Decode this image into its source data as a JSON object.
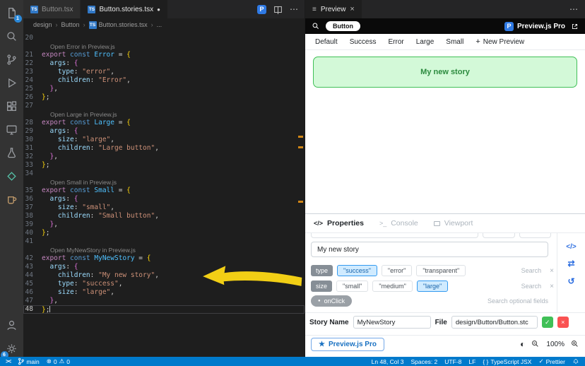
{
  "colors": {
    "accent": "#007acc",
    "preview_button_bg": "#d3f9d8",
    "preview_button_border": "#40c057",
    "selected_pill_bg": "#d0ebff",
    "annotation_arrow": "#f2cf15",
    "scroll_mark_orange": "#d18616"
  },
  "icons": {
    "ts": "TS",
    "p": "P",
    "ellipsis": "⋯",
    "close": "×",
    "dot": "●",
    "menu": "≡",
    "crumb_sep": "›",
    "code": "</>",
    "console": ">_",
    "swap": "⇄",
    "undo": "↺",
    "contrast": "◐",
    "star": "★",
    "check": "✓",
    "plus": "+",
    "braces": "{ }",
    "remote": "><",
    "error": "⊗",
    "warning": "⚠"
  },
  "activity_bar": {
    "explorer_badge": "1",
    "settings_badge": "6"
  },
  "tabs": [
    {
      "label": "Button.tsx"
    },
    {
      "label": "Button.stories.tsx"
    }
  ],
  "breadcrumb": {
    "items": [
      "design",
      "Button",
      "Button.stories.tsx",
      "..."
    ]
  },
  "editor": {
    "rows": [
      {
        "n": "20"
      },
      {
        "lens": "Open Error in Preview.js"
      },
      {
        "n": "21",
        "t": [
          [
            "k1",
            "export "
          ],
          [
            "k2",
            "const "
          ],
          [
            "nm",
            "Error"
          ],
          [
            "pn",
            " = "
          ],
          [
            "b1",
            "{"
          ]
        ]
      },
      {
        "n": "22",
        "t": [
          [
            "pn",
            "  "
          ],
          [
            "pr",
            "args"
          ],
          [
            "pn",
            ": "
          ],
          [
            "b2",
            "{"
          ]
        ]
      },
      {
        "n": "23",
        "t": [
          [
            "pn",
            "    "
          ],
          [
            "pr",
            "type"
          ],
          [
            "pn",
            ": "
          ],
          [
            "st",
            "\"error\""
          ],
          [
            "pn",
            ","
          ]
        ]
      },
      {
        "n": "24",
        "t": [
          [
            "pn",
            "    "
          ],
          [
            "pr",
            "children"
          ],
          [
            "pn",
            ": "
          ],
          [
            "st",
            "\"Error\""
          ],
          [
            "pn",
            ","
          ]
        ]
      },
      {
        "n": "25",
        "t": [
          [
            "pn",
            "  "
          ],
          [
            "b2",
            "}"
          ],
          [
            "pn",
            ","
          ]
        ]
      },
      {
        "n": "26",
        "t": [
          [
            "b1",
            "}"
          ],
          [
            "pn",
            ";"
          ]
        ]
      },
      {
        "n": "27"
      },
      {
        "lens": "Open Large in Preview.js"
      },
      {
        "n": "28",
        "t": [
          [
            "k1",
            "export "
          ],
          [
            "k2",
            "const "
          ],
          [
            "nm",
            "Large"
          ],
          [
            "pn",
            " = "
          ],
          [
            "b1",
            "{"
          ]
        ]
      },
      {
        "n": "29",
        "t": [
          [
            "pn",
            "  "
          ],
          [
            "pr",
            "args"
          ],
          [
            "pn",
            ": "
          ],
          [
            "b2",
            "{"
          ]
        ]
      },
      {
        "n": "30",
        "t": [
          [
            "pn",
            "    "
          ],
          [
            "pr",
            "size"
          ],
          [
            "pn",
            ": "
          ],
          [
            "st",
            "\"large\""
          ],
          [
            "pn",
            ","
          ]
        ]
      },
      {
        "n": "31",
        "t": [
          [
            "pn",
            "    "
          ],
          [
            "pr",
            "children"
          ],
          [
            "pn",
            ": "
          ],
          [
            "st",
            "\"Large button\""
          ],
          [
            "pn",
            ","
          ]
        ]
      },
      {
        "n": "32",
        "t": [
          [
            "pn",
            "  "
          ],
          [
            "b2",
            "}"
          ],
          [
            "pn",
            ","
          ]
        ]
      },
      {
        "n": "33",
        "t": [
          [
            "b1",
            "}"
          ],
          [
            "pn",
            ";"
          ]
        ]
      },
      {
        "n": "34"
      },
      {
        "lens": "Open Small in Preview.js"
      },
      {
        "n": "35",
        "t": [
          [
            "k1",
            "export "
          ],
          [
            "k2",
            "const "
          ],
          [
            "nm",
            "Small"
          ],
          [
            "pn",
            " = "
          ],
          [
            "b1",
            "{"
          ]
        ]
      },
      {
        "n": "36",
        "t": [
          [
            "pn",
            "  "
          ],
          [
            "pr",
            "args"
          ],
          [
            "pn",
            ": "
          ],
          [
            "b2",
            "{"
          ]
        ]
      },
      {
        "n": "37",
        "t": [
          [
            "pn",
            "    "
          ],
          [
            "pr",
            "size"
          ],
          [
            "pn",
            ": "
          ],
          [
            "st",
            "\"small\""
          ],
          [
            "pn",
            ","
          ]
        ]
      },
      {
        "n": "38",
        "t": [
          [
            "pn",
            "    "
          ],
          [
            "pr",
            "children"
          ],
          [
            "pn",
            ": "
          ],
          [
            "st",
            "\"Small button\""
          ],
          [
            "pn",
            ","
          ]
        ]
      },
      {
        "n": "39",
        "t": [
          [
            "pn",
            "  "
          ],
          [
            "b2",
            "}"
          ],
          [
            "pn",
            ","
          ]
        ]
      },
      {
        "n": "40",
        "t": [
          [
            "b1",
            "}"
          ],
          [
            "pn",
            ";"
          ]
        ]
      },
      {
        "n": "41"
      },
      {
        "lens": "Open MyNewStory in Preview.js"
      },
      {
        "n": "42",
        "t": [
          [
            "k1",
            "export "
          ],
          [
            "k2",
            "const "
          ],
          [
            "nm",
            "MyNewStory"
          ],
          [
            "pn",
            " = "
          ],
          [
            "b1",
            "{"
          ]
        ]
      },
      {
        "n": "43",
        "t": [
          [
            "pn",
            "  "
          ],
          [
            "pr",
            "args"
          ],
          [
            "pn",
            ": "
          ],
          [
            "b2",
            "{"
          ]
        ]
      },
      {
        "n": "44",
        "t": [
          [
            "pn",
            "    "
          ],
          [
            "pr",
            "children"
          ],
          [
            "pn",
            ": "
          ],
          [
            "st",
            "\"My new story\""
          ],
          [
            "pn",
            ","
          ]
        ]
      },
      {
        "n": "45",
        "t": [
          [
            "pn",
            "    "
          ],
          [
            "pr",
            "type"
          ],
          [
            "pn",
            ": "
          ],
          [
            "st",
            "\"success\""
          ],
          [
            "pn",
            ","
          ]
        ]
      },
      {
        "n": "46",
        "t": [
          [
            "pn",
            "    "
          ],
          [
            "pr",
            "size"
          ],
          [
            "pn",
            ": "
          ],
          [
            "st",
            "\"large\""
          ],
          [
            "pn",
            ","
          ]
        ]
      },
      {
        "n": "47",
        "t": [
          [
            "pn",
            "  "
          ],
          [
            "b2",
            "}"
          ],
          [
            "pn",
            ","
          ]
        ]
      },
      {
        "n": "48",
        "cur": true,
        "t": [
          [
            "b1",
            "}"
          ],
          [
            "pn",
            ";"
          ]
        ]
      }
    ]
  },
  "preview": {
    "tab_label": "Preview",
    "filter_chip": "Button",
    "brand": "Preview.js Pro",
    "variants": [
      "Default",
      "Success",
      "Error",
      "Large",
      "Small"
    ],
    "new_preview": "New Preview",
    "story_button": "My new story",
    "panel_tabs": [
      {
        "label": "Properties"
      },
      {
        "label": "Console"
      },
      {
        "label": "Viewport"
      }
    ]
  },
  "properties": {
    "main_value": "My new story",
    "rows": [
      {
        "key": "type",
        "options": [
          "\"success\"",
          "\"error\"",
          "\"transparent\""
        ],
        "selected": 0,
        "search": "Search"
      },
      {
        "key": "size",
        "options": [
          "\"small\"",
          "\"medium\"",
          "\"large\""
        ],
        "selected": 2,
        "search": "Search"
      }
    ],
    "onclick": "onClick",
    "hint": "Search optional fields"
  },
  "story": {
    "name_label": "Story Name",
    "name_value": "MyNewStory",
    "file_label": "File",
    "file_value": "design/Button/Button.stc"
  },
  "footer": {
    "pro": "Preview.js Pro",
    "zoom": "100%"
  },
  "status": {
    "branch": "main",
    "errors": "0",
    "warnings": "0",
    "line_col": "Ln 48, Col 3",
    "spaces": "Spaces: 2",
    "encoding": "UTF-8",
    "eol": "LF",
    "language": "TypeScript JSX",
    "formatter": "Prettier"
  }
}
